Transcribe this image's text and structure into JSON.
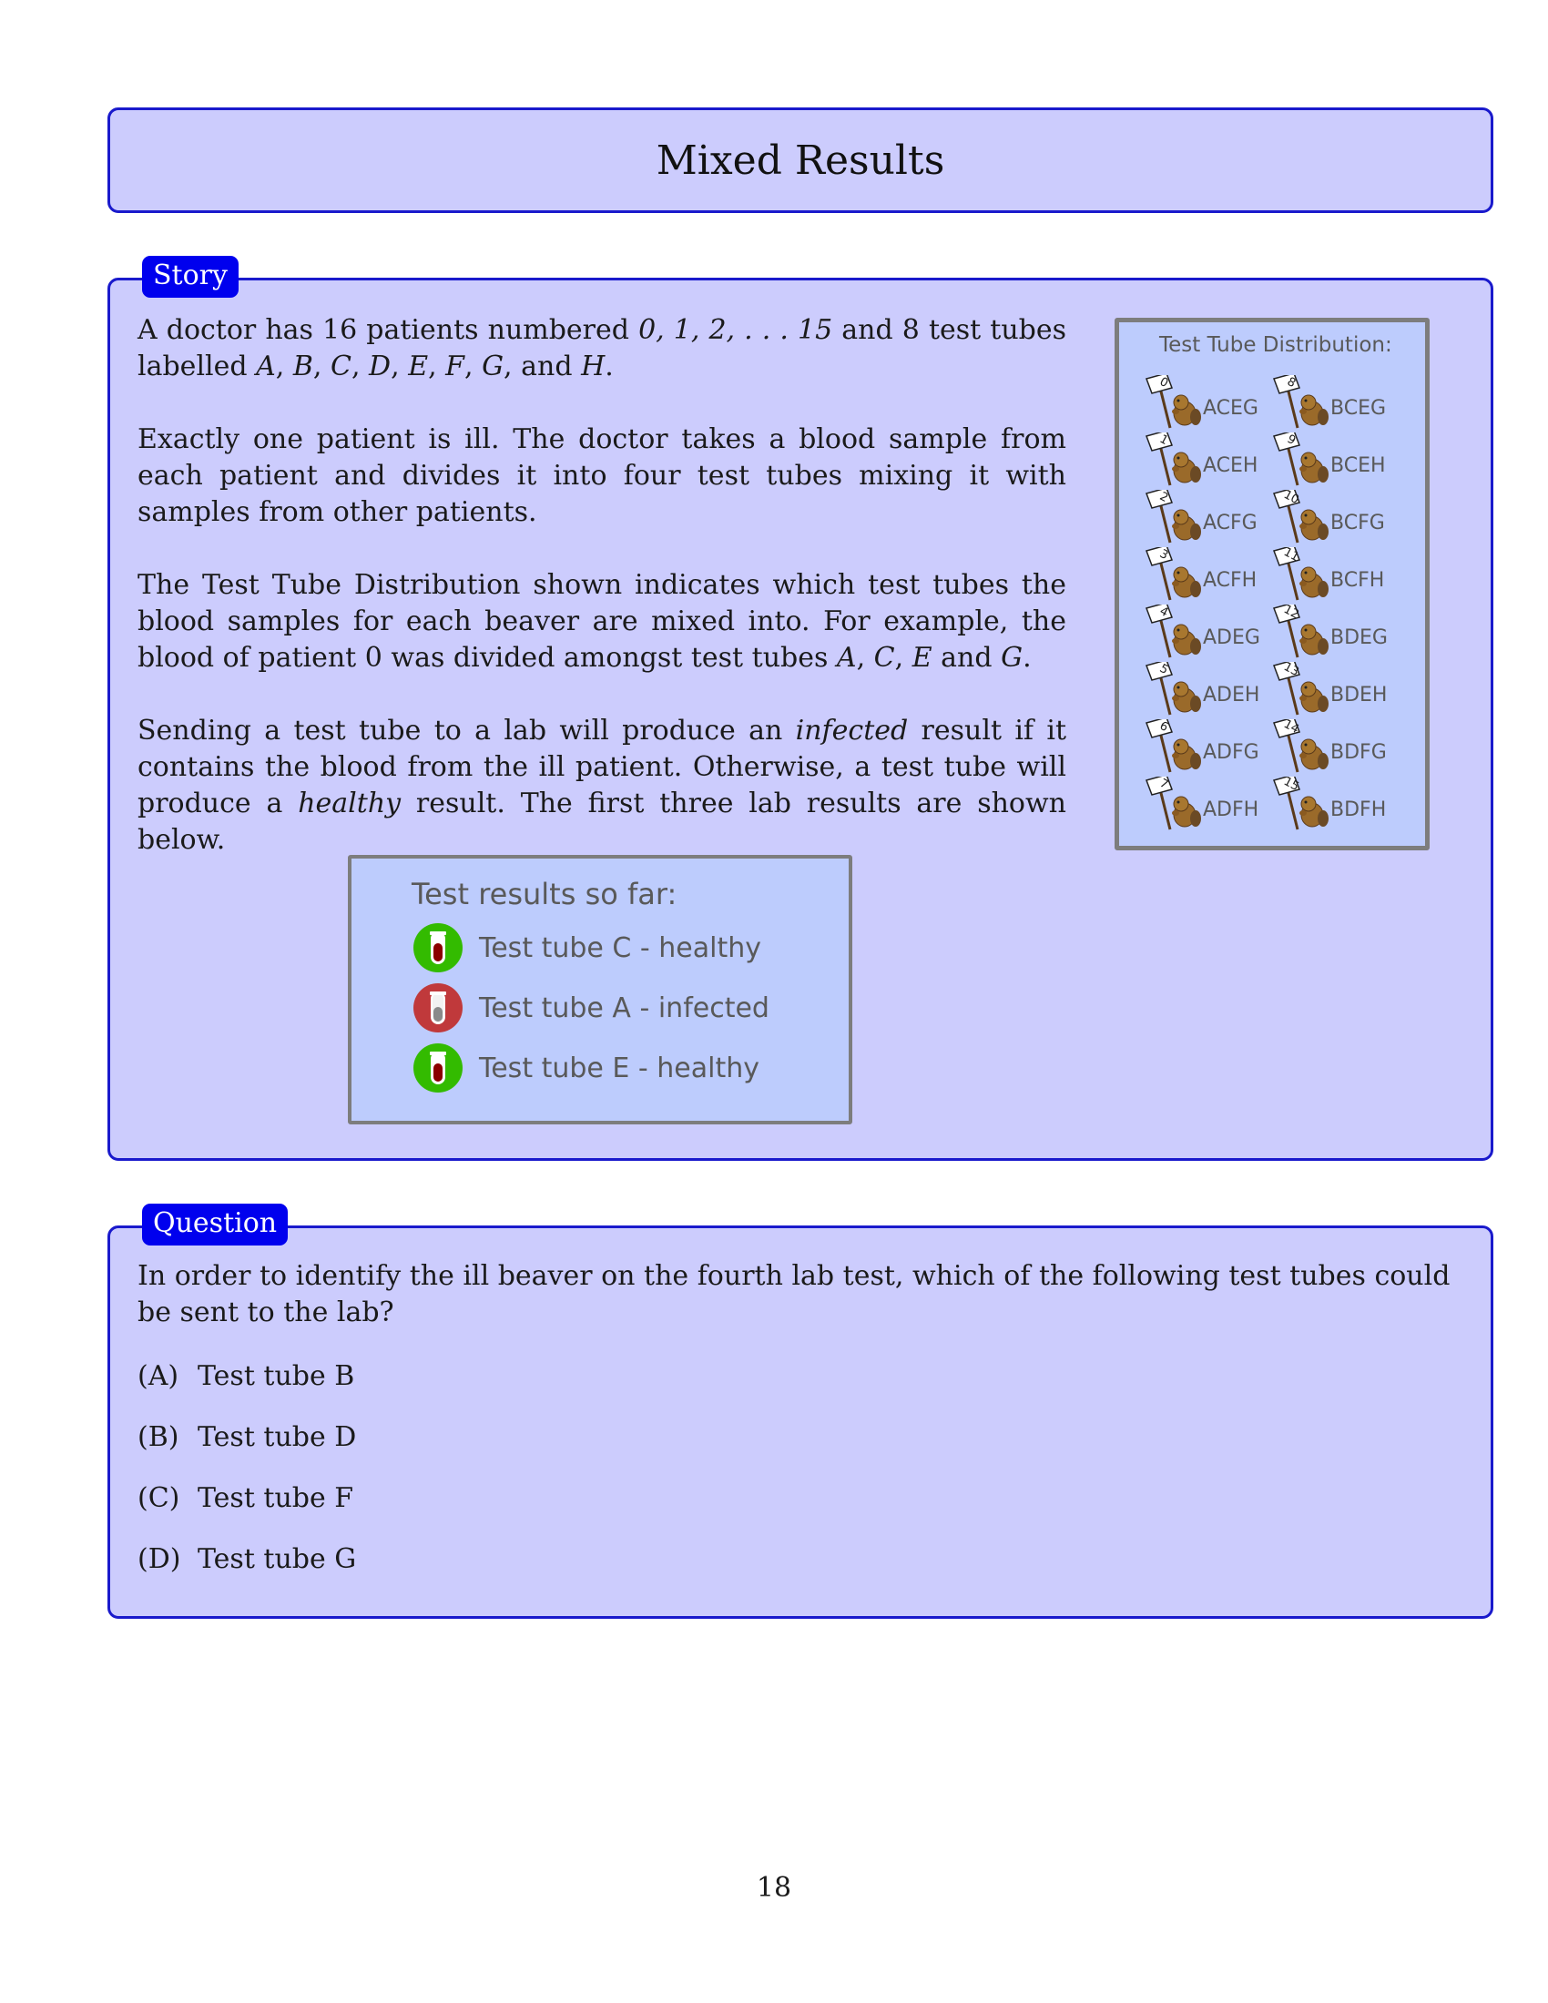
{
  "title": "Mixed Results",
  "story": {
    "tag": "Story",
    "paragraphs": [
      [
        {
          "t": "A doctor has 16 patients numbered "
        },
        {
          "t": "0, 1, 2, . . . 15",
          "m": true
        },
        {
          "t": " and 8 test tubes labelled "
        },
        {
          "t": "A",
          "m": true
        },
        {
          "t": ", "
        },
        {
          "t": "B",
          "m": true
        },
        {
          "t": ", "
        },
        {
          "t": "C",
          "m": true
        },
        {
          "t": ", "
        },
        {
          "t": "D",
          "m": true
        },
        {
          "t": ", "
        },
        {
          "t": "E",
          "m": true
        },
        {
          "t": ", "
        },
        {
          "t": "F",
          "m": true
        },
        {
          "t": ", "
        },
        {
          "t": "G",
          "m": true
        },
        {
          "t": ", and "
        },
        {
          "t": "H",
          "m": true
        },
        {
          "t": "."
        }
      ],
      [
        {
          "t": "Exactly one patient is ill. The doctor takes a blood sample from each patient and divides it into four test tubes mixing it with samples from other patients."
        }
      ],
      [
        {
          "t": "The Test Tube Distribution shown indicates which test tubes the blood samples for each beaver are mixed into. For example, the blood of patient 0 was divided amongst test tubes "
        },
        {
          "t": "A",
          "m": true
        },
        {
          "t": ", "
        },
        {
          "t": "C",
          "m": true
        },
        {
          "t": ", "
        },
        {
          "t": "E",
          "m": true
        },
        {
          "t": " and "
        },
        {
          "t": "G",
          "m": true
        },
        {
          "t": "."
        }
      ],
      [
        {
          "t": "Sending a test tube to a lab will produce an "
        },
        {
          "t": "infected",
          "m": true
        },
        {
          "t": " result if it contains the blood from the ill patient. Otherwise, a test tube will produce a "
        },
        {
          "t": "healthy",
          "m": true
        },
        {
          "t": " result. The first three lab results are shown below."
        }
      ]
    ],
    "results": {
      "title": "Test results so far:",
      "items": [
        {
          "label": "Test tube C - healthy",
          "status": "healthy",
          "color": "#33bb00"
        },
        {
          "label": "Test tube A - infected",
          "status": "infected",
          "color": "#c0393b"
        },
        {
          "label": "Test tube E - healthy",
          "status": "healthy",
          "color": "#33bb00"
        }
      ]
    },
    "distribution": {
      "title": "Test Tube Distribution:",
      "icon": "beaver-holding-sign-icon",
      "patients": [
        {
          "num": "0",
          "tubes": "ACEG"
        },
        {
          "num": "1",
          "tubes": "ACEH"
        },
        {
          "num": "2",
          "tubes": "ACFG"
        },
        {
          "num": "3",
          "tubes": "ACFH"
        },
        {
          "num": "4",
          "tubes": "ADEG"
        },
        {
          "num": "5",
          "tubes": "ADEH"
        },
        {
          "num": "6",
          "tubes": "ADFG"
        },
        {
          "num": "7",
          "tubes": "ADFH"
        },
        {
          "num": "8",
          "tubes": "BCEG"
        },
        {
          "num": "9",
          "tubes": "BCEH"
        },
        {
          "num": "10",
          "tubes": "BCFG"
        },
        {
          "num": "11",
          "tubes": "BCFH"
        },
        {
          "num": "12",
          "tubes": "BDEG"
        },
        {
          "num": "13",
          "tubes": "BDEH"
        },
        {
          "num": "14",
          "tubes": "BDFG"
        },
        {
          "num": "15",
          "tubes": "BDFH"
        }
      ]
    }
  },
  "question": {
    "tag": "Question",
    "text": "In order to identify the ill beaver on the fourth lab test, which of the following test tubes could be sent to the lab?",
    "options": [
      {
        "letter": "(A)",
        "text": "Test tube B"
      },
      {
        "letter": "(B)",
        "text": "Test tube D"
      },
      {
        "letter": "(C)",
        "text": "Test tube F"
      },
      {
        "letter": "(D)",
        "text": "Test tube G"
      }
    ]
  },
  "page_number": "18",
  "colors": {
    "box_fill": "#ccccfd",
    "box_border": "#1a1acc",
    "tag_fill": "#0000ee",
    "panel_fill": "#bdccfd",
    "panel_border": "#7d7d7d"
  }
}
